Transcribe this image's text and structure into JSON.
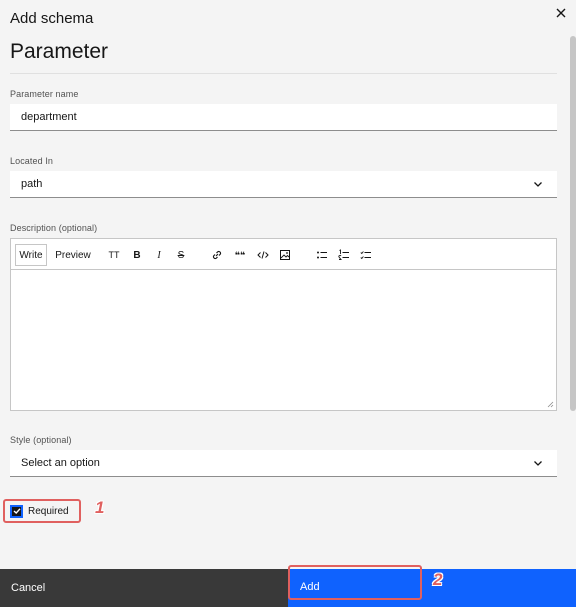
{
  "modal": {
    "header_label": "Add schema",
    "title": "Parameter",
    "close_icon": "close-icon"
  },
  "form": {
    "parameter_name": {
      "label": "Parameter name",
      "value": "department"
    },
    "located_in": {
      "label": "Located In",
      "value": "path"
    },
    "description": {
      "label": "Description (optional)",
      "tabs": [
        "Write",
        "Preview"
      ],
      "active_tab": "Write",
      "toolbar_icons": [
        "heading-icon",
        "bold-icon",
        "italic-icon",
        "strikethrough-icon",
        "link-icon",
        "quote-icon",
        "code-icon",
        "image-icon",
        "bulleted-list-icon",
        "numbered-list-icon",
        "task-list-icon"
      ],
      "toolbar_glyphs": {
        "heading": "TT",
        "bold": "B",
        "italic": "I",
        "strikethrough": "S",
        "quote": "❝❝"
      },
      "value": ""
    },
    "style": {
      "label": "Style (optional)",
      "placeholder": "Select an option"
    },
    "required": {
      "label": "Required",
      "checked": true
    }
  },
  "annotations": {
    "badge_1": "1",
    "badge_2": "2",
    "color": "#e0605f"
  },
  "footer": {
    "cancel_label": "Cancel",
    "add_label": "Add"
  },
  "colors": {
    "primary": "#0f62fe",
    "secondary": "#393939",
    "background": "#f4f4f4"
  }
}
